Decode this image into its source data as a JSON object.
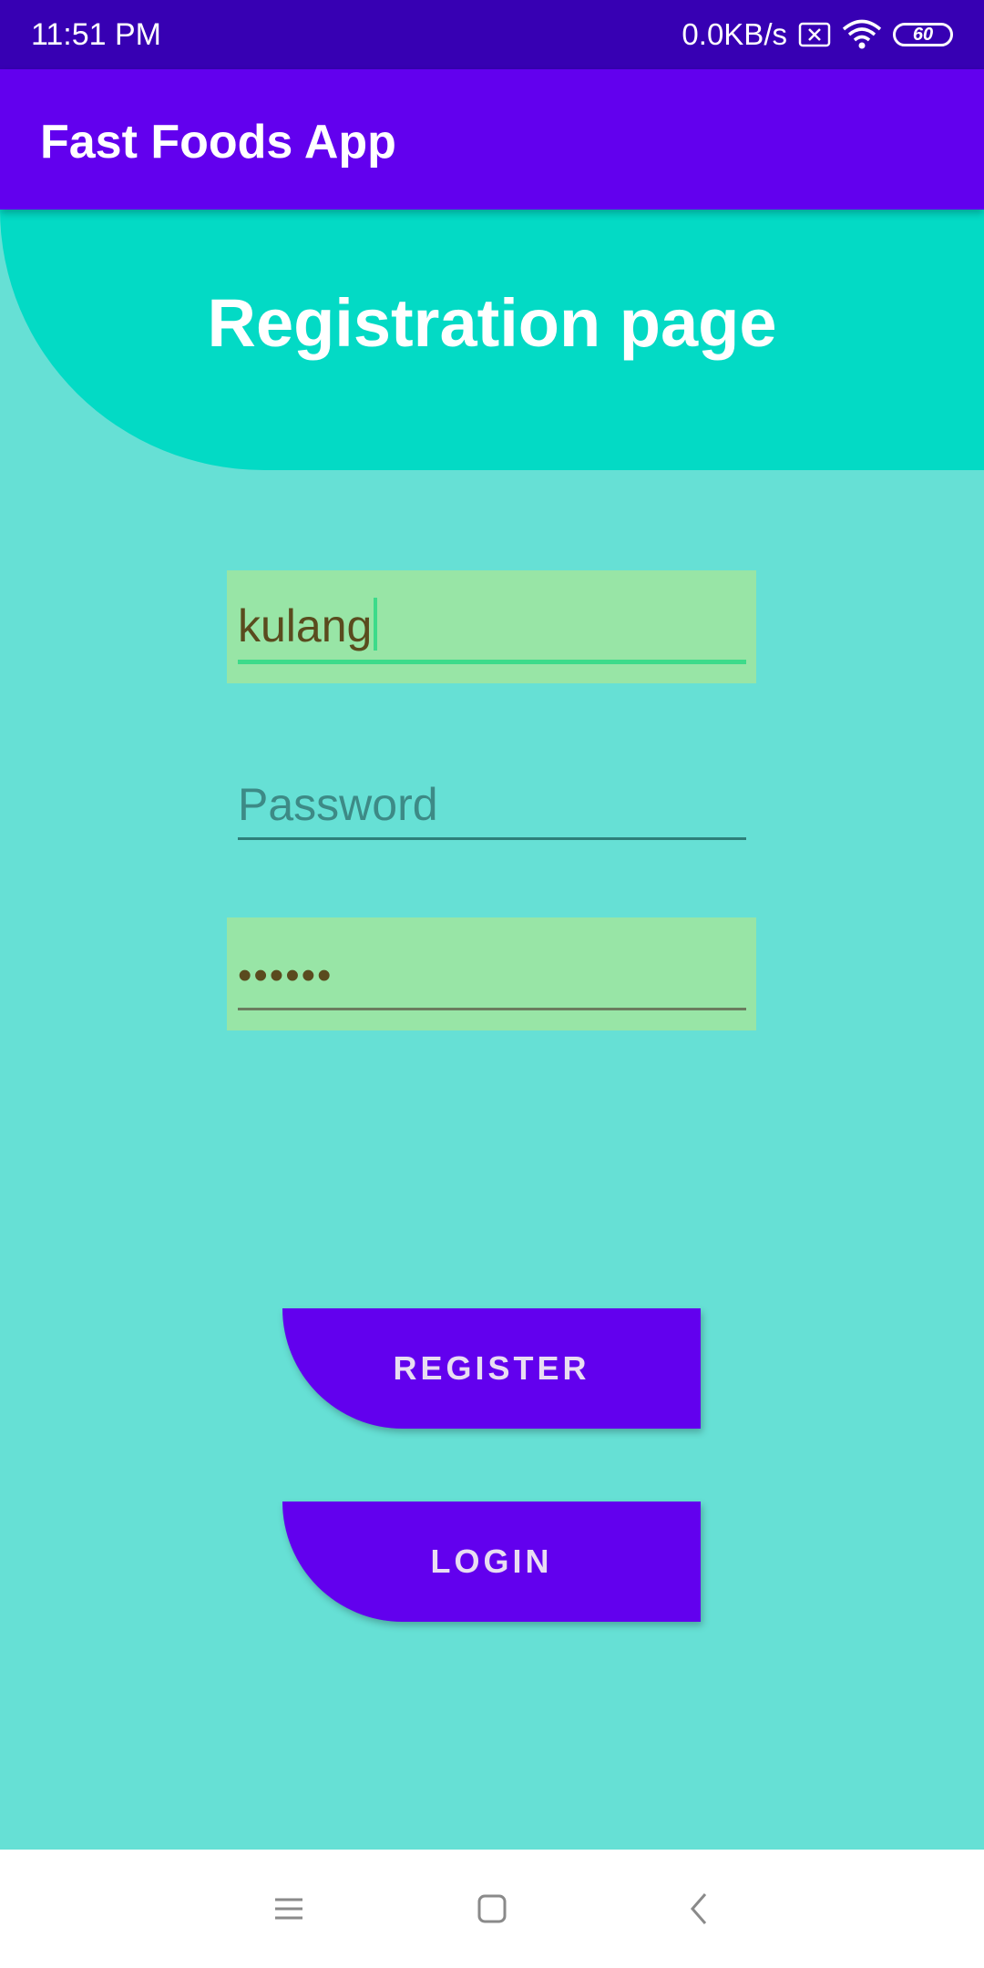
{
  "status_bar": {
    "time": "11:51 PM",
    "net_speed": "0.0KB/s",
    "battery_level": "60",
    "icons": [
      "data-off-icon",
      "wifi-icon",
      "battery-icon"
    ]
  },
  "app_bar": {
    "title": "Fast Foods App"
  },
  "header": {
    "title": "Registration page"
  },
  "form": {
    "username_value": "kulang",
    "password_placeholder": "Password",
    "password_value": "••••••"
  },
  "buttons": {
    "register_label": "REGISTER",
    "login_label": "LOGIN"
  },
  "nav_bar": {
    "icons": [
      "menu-icon",
      "home-icon",
      "back-icon"
    ]
  },
  "colors": {
    "status_bar": "#3700B3",
    "primary": "#6200EE",
    "accent": "#03DAC5",
    "background": "#66E0D5",
    "field_fill": "#98E5A6"
  }
}
